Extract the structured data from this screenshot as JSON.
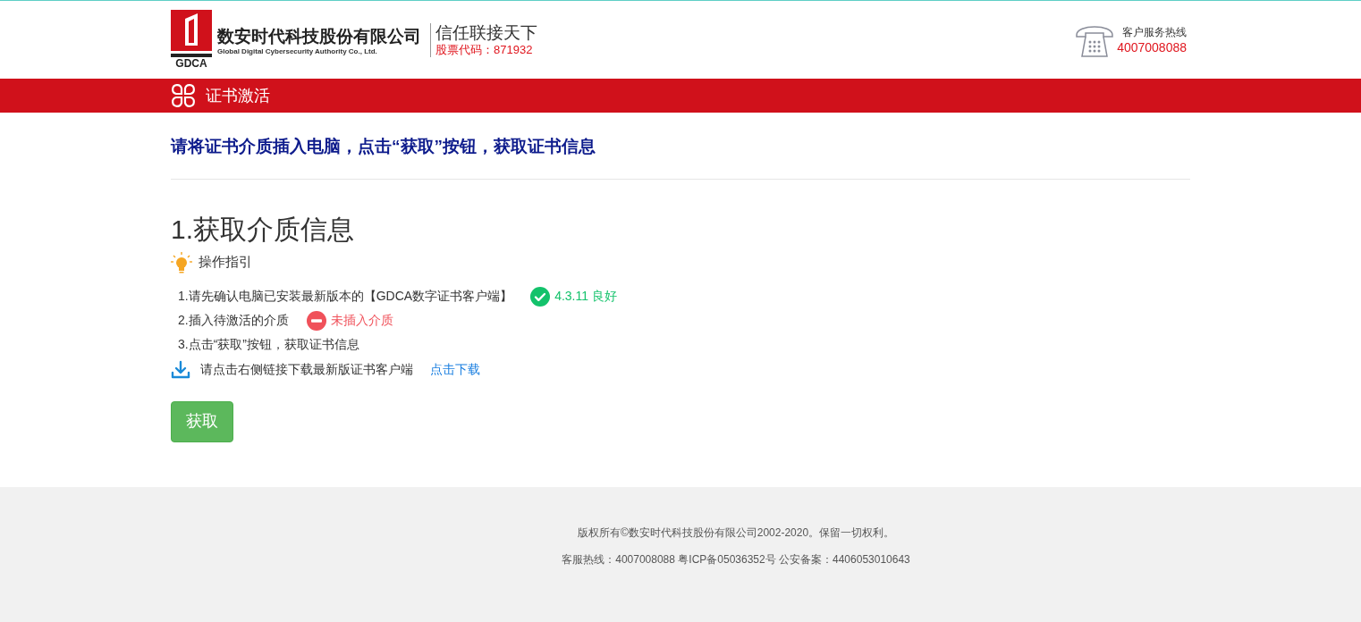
{
  "header": {
    "logo_text": "GDCA",
    "company_name": "数安时代科技股份有限公司",
    "company_name_en": "Global Digital Cybersecurity Authority Co., Ltd.",
    "slogan": "信任联接天下",
    "stock_code": "股票代码：871932",
    "hotline_label": "客户服务热线",
    "hotline_number": "4007008088"
  },
  "nav": {
    "title": "证书激活"
  },
  "instruction": "请将证书介质插入电脑，点击“获取”按钮，获取证书信息",
  "section": {
    "title": "1.获取介质信息",
    "guide_label": "操作指引",
    "steps": [
      {
        "text": "1.请先确认电脑已安装最新版本的【GDCA数字证书客户端】",
        "status": {
          "kind": "ok",
          "text": "4.3.11 良好"
        }
      },
      {
        "text": "2.插入待激活的介质",
        "status": {
          "kind": "error",
          "text": "未插入介质"
        }
      },
      {
        "text": "3.点击“获取”按钮，获取证书信息"
      }
    ],
    "download": {
      "text": "请点击右侧链接下载最新版证书客户端",
      "link": "点击下载"
    },
    "button": "获取"
  },
  "footer": {
    "copyright": "版权所有©数安时代科技股份有限公司2002-2020。保留一切权利。",
    "info": "客服热线：4007008088 粤ICP备05036352号 公安备案：4406053010643"
  }
}
